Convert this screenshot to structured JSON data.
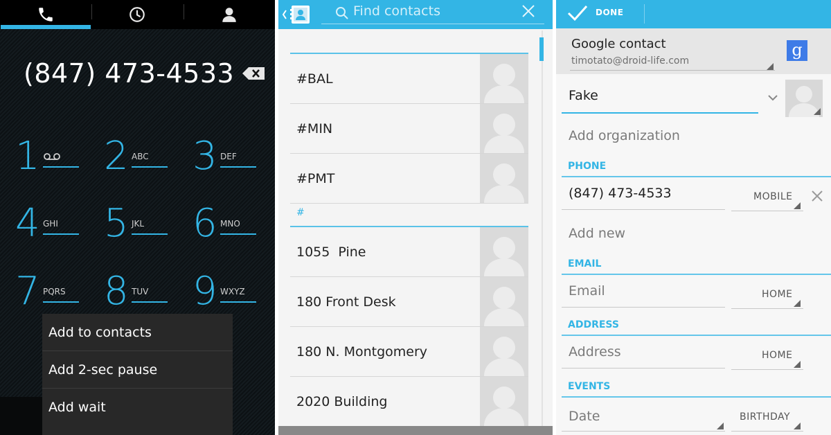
{
  "dialer": {
    "tabs": [
      {
        "icon": "phone-icon",
        "active": true
      },
      {
        "icon": "clock-icon",
        "active": false
      },
      {
        "icon": "person-icon",
        "active": false
      }
    ],
    "number": "(847) 473-4533",
    "keys": [
      {
        "digit": "1",
        "letters": ""
      },
      {
        "digit": "2",
        "letters": "ABC"
      },
      {
        "digit": "3",
        "letters": "DEF"
      },
      {
        "digit": "4",
        "letters": "GHI"
      },
      {
        "digit": "5",
        "letters": "JKL"
      },
      {
        "digit": "6",
        "letters": "MNO"
      },
      {
        "digit": "7",
        "letters": "PQRS"
      },
      {
        "digit": "8",
        "letters": "TUV"
      },
      {
        "digit": "9",
        "letters": "WXYZ"
      }
    ],
    "menu": [
      "Add to contacts",
      "Add 2-sec pause",
      "Add wait"
    ],
    "accent": "#33b5e5"
  },
  "contacts": {
    "search_placeholder": "Find contacts",
    "group_one": [
      "#BAL",
      "#MIN",
      "#PMT"
    ],
    "section_header": "#",
    "group_two": [
      "1055  Pine",
      "180 Front Desk",
      "180 N. Montgomery",
      "2020 Building"
    ]
  },
  "editor": {
    "done_label": "DONE",
    "account_name": "Google contact",
    "account_email": "timotato@droid-life.com",
    "name_value": "Fake",
    "add_organization": "Add organization",
    "phone_header": "PHONE",
    "phone_value": "(847) 473-4533",
    "phone_type": "MOBILE",
    "add_new": "Add new",
    "email_header": "EMAIL",
    "email_placeholder": "Email",
    "email_type": "HOME",
    "address_header": "ADDRESS",
    "address_placeholder": "Address",
    "address_type": "HOME",
    "events_header": "EVENTS",
    "date_placeholder": "Date",
    "date_type": "BIRTHDAY"
  }
}
